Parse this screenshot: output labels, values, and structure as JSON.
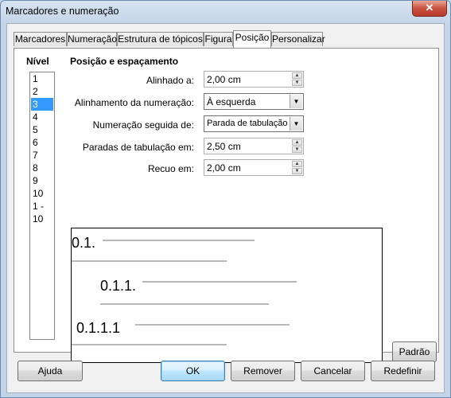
{
  "window": {
    "title": "Marcadores e numeração",
    "close_glyph": "✕"
  },
  "tabs": [
    {
      "label": "Marcadores",
      "active": false
    },
    {
      "label": "Numeração",
      "active": false
    },
    {
      "label": "Estrutura de tópicos",
      "active": false
    },
    {
      "label": "Figura",
      "active": false
    },
    {
      "label": "Posição",
      "active": true
    },
    {
      "label": "Personalizar",
      "active": false
    }
  ],
  "level": {
    "heading": "Nível",
    "items": [
      "1",
      "2",
      "3",
      "4",
      "5",
      "6",
      "7",
      "8",
      "9",
      "10",
      "1 - 10"
    ],
    "selected": "3"
  },
  "position": {
    "heading": "Posição e espaçamento",
    "aligned_at": {
      "label": "Alinhado a:",
      "value": "2,00 cm"
    },
    "numbering_alignment": {
      "label": "Alinhamento da numeração:",
      "value": "À esquerda"
    },
    "numbering_followed_by": {
      "label": "Numeração seguida de:",
      "value": "Parada de tabulação"
    },
    "tab_stop_at": {
      "label": "Paradas de tabulação em:",
      "value": "2,50 cm"
    },
    "indent_at": {
      "label": "Recuo em:",
      "value": "2,00 cm"
    }
  },
  "preview": {
    "numbers": [
      "0.1.",
      "0.1.1.",
      "0.1.1.1"
    ]
  },
  "buttons": {
    "default": "Padrão",
    "help": "Ajuda",
    "ok": "OK",
    "remove": "Remover",
    "cancel": "Cancelar",
    "reset": "Redefinir"
  },
  "icons": {
    "spin_up": "▲",
    "spin_down": "▼",
    "dropdown": "▼"
  }
}
